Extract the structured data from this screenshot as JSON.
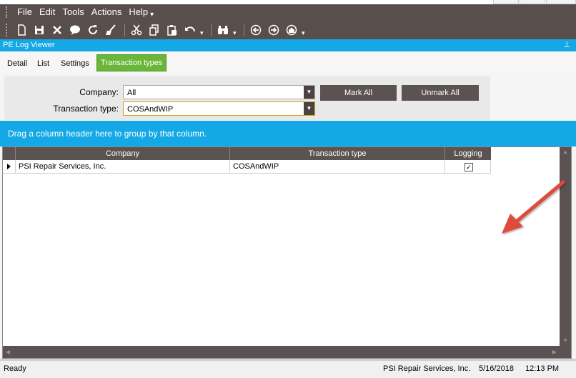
{
  "menu": {
    "items": [
      "File",
      "Edit",
      "Tools",
      "Actions",
      "Help"
    ]
  },
  "toolbar": {
    "icons": [
      "new-document-icon",
      "save-icon",
      "delete-icon",
      "comment-icon",
      "refresh-icon",
      "clear-icon",
      "cut-icon",
      "copy-icon",
      "paste-icon",
      "undo-icon",
      "find-icon",
      "back-icon",
      "forward-icon",
      "home-icon"
    ]
  },
  "panel": {
    "title": "PE Log Viewer",
    "pin_glyph": "⊥"
  },
  "tabs": [
    {
      "label": "Detail"
    },
    {
      "label": "List"
    },
    {
      "label": "Settings"
    },
    {
      "label": "Transaction types",
      "active": true
    }
  ],
  "filters": {
    "company_label": "Company:",
    "company_value": "All",
    "transaction_type_label": "Transaction type:",
    "transaction_type_value": "COSAndWIP",
    "mark_all": "Mark All",
    "unmark_all": "Unmark All"
  },
  "group_panel": {
    "text": "Drag a column header here to group by that column."
  },
  "grid": {
    "columns": [
      "Company",
      "Transaction type",
      "Logging"
    ],
    "rows": [
      {
        "company": "PSI Repair Services, Inc.",
        "transaction_type": "COSAndWIP",
        "logging": "✓"
      }
    ]
  },
  "status": {
    "left": "Ready",
    "company": "PSI Repair Services, Inc.",
    "date": "5/16/2018",
    "time": "12:13 PM"
  },
  "colors": {
    "accent_blue": "#14a9e6",
    "dark_band": "#584f4c",
    "active_tab": "#6ab638",
    "annotation_arrow": "#e2483c"
  }
}
